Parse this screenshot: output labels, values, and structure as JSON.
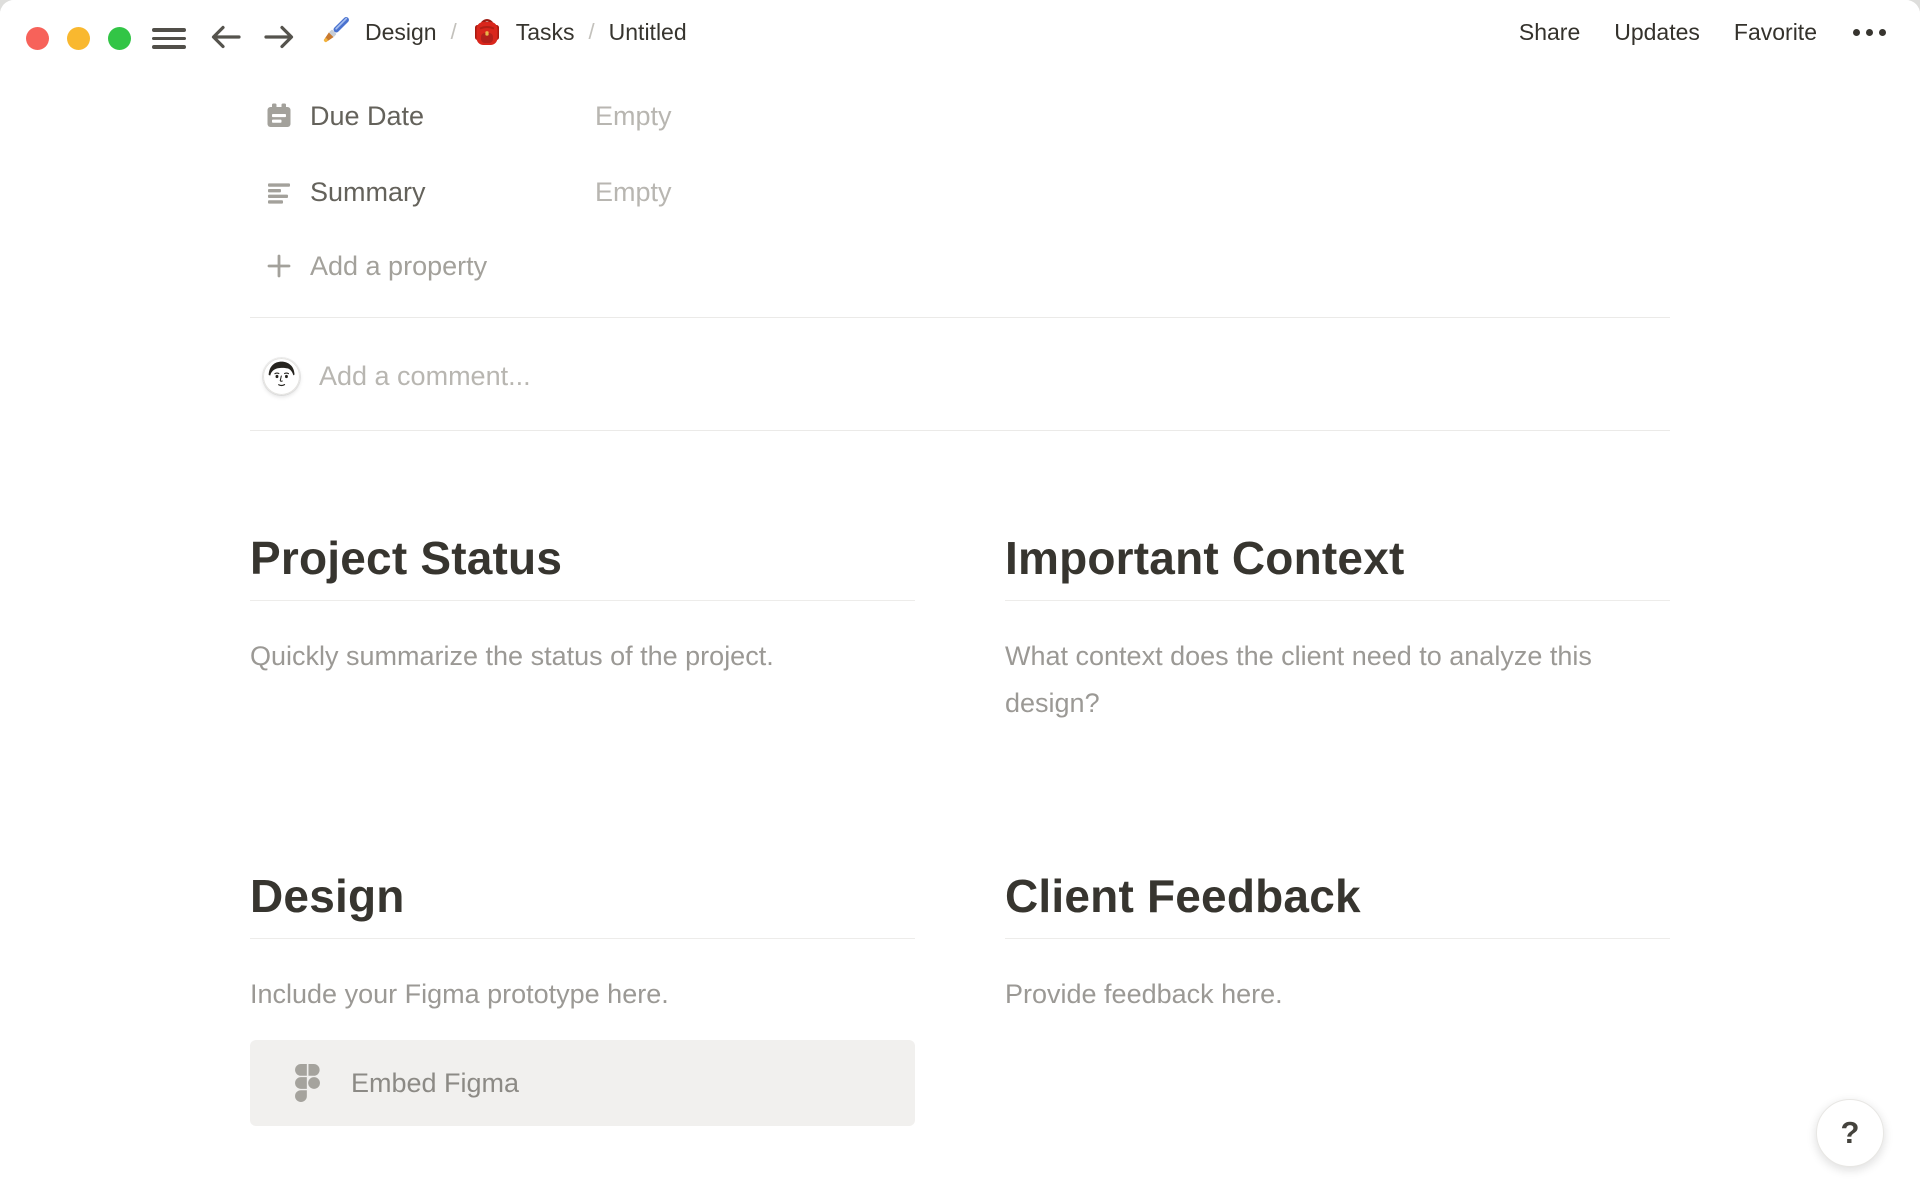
{
  "topbar": {
    "window_controls": [
      "close",
      "minimize",
      "zoom"
    ],
    "menu_icon": "hamburger-icon",
    "back_icon": "arrow-left-icon",
    "forward_icon": "arrow-right-icon",
    "breadcrumb": {
      "separator": "/",
      "items": [
        {
          "icon": "paintbrush-emoji-icon",
          "label": "Design"
        },
        {
          "icon": "backpack-emoji-icon",
          "label": "Tasks"
        },
        {
          "icon": null,
          "label": "Untitled"
        }
      ]
    },
    "actions": {
      "share": "Share",
      "updates": "Updates",
      "favorite": "Favorite",
      "more_icon": "ellipsis-icon"
    }
  },
  "properties": {
    "rows": [
      {
        "icon": "calendar-icon",
        "label": "Due Date",
        "value": "Empty"
      },
      {
        "icon": "text-lines-icon",
        "label": "Summary",
        "value": "Empty"
      }
    ],
    "add_property": "Add a property",
    "add_icon": "plus-icon"
  },
  "comment": {
    "avatar": "user-avatar",
    "placeholder": "Add a comment..."
  },
  "sections": [
    {
      "title": "Project Status",
      "body": "Quickly summarize the status of the project."
    },
    {
      "title": "Important Context",
      "body": "What context does the client need to analyze this design?"
    },
    {
      "title": "Design",
      "body": "Include your Figma prototype here.",
      "embed": {
        "icon": "figma-icon",
        "label": "Embed Figma"
      }
    },
    {
      "title": "Client Feedback",
      "body": "Provide feedback here."
    }
  ],
  "help": {
    "label": "?"
  },
  "colors": {
    "traffic_red": "#f7625a",
    "traffic_yellow": "#f9b82f",
    "traffic_green": "#32c546",
    "text": "#37352f",
    "label_gray": "#64625b",
    "muted_gray": "#9b9995",
    "faint_gray": "#b8b6b1",
    "divider": "#ebeae8",
    "block_background": "#f1f0ee"
  }
}
